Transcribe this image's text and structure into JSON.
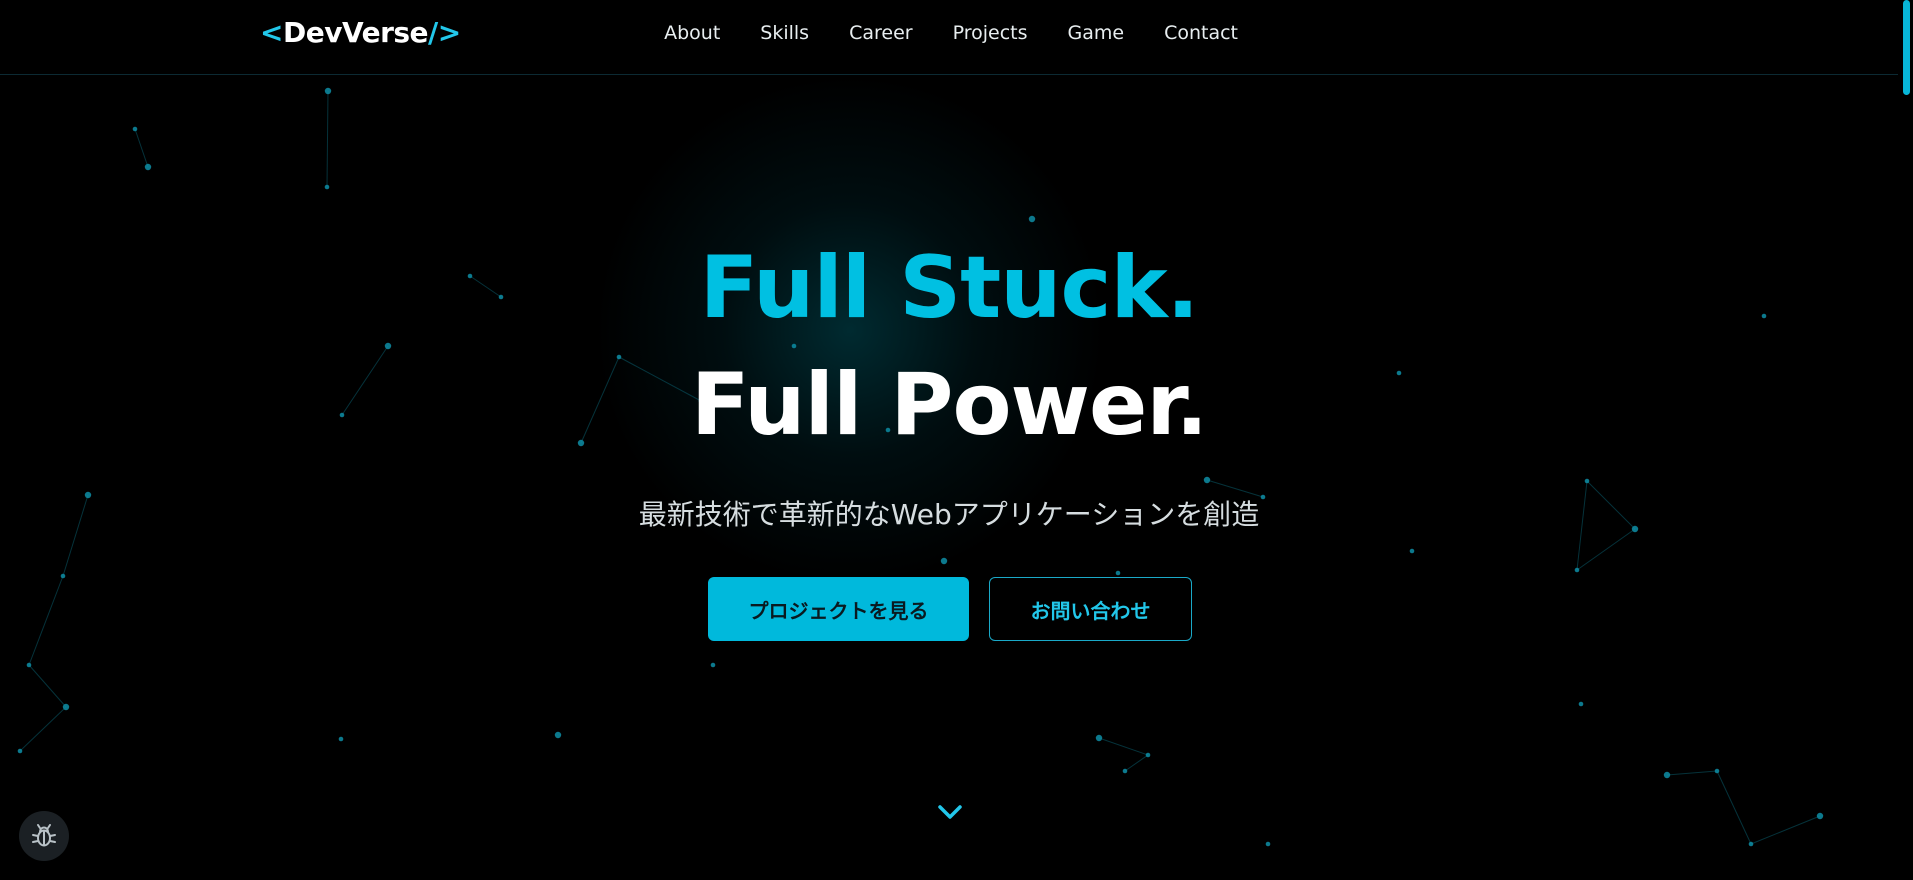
{
  "header": {
    "logo": {
      "open": "<",
      "name": "DevVerse",
      "close": "/>"
    },
    "nav": [
      {
        "label": "About"
      },
      {
        "label": "Skills"
      },
      {
        "label": "Career"
      },
      {
        "label": "Projects"
      },
      {
        "label": "Game"
      },
      {
        "label": "Contact"
      }
    ]
  },
  "hero": {
    "title_line1": "Full Stuck.",
    "title_line2": "Full Power.",
    "subtitle": "最新技術で革新的なWebアプリケーションを創造",
    "primary_button": "プロジェクトを見る",
    "secondary_button": "お問い合わせ",
    "scroll_icon": "chevron-down-icon"
  },
  "floating": {
    "debug_icon": "bug-icon"
  },
  "colors": {
    "accent": "#00c0e2",
    "background": "#000000",
    "button_primary": "#00b9dc",
    "particle": "#0e8ea6"
  }
}
